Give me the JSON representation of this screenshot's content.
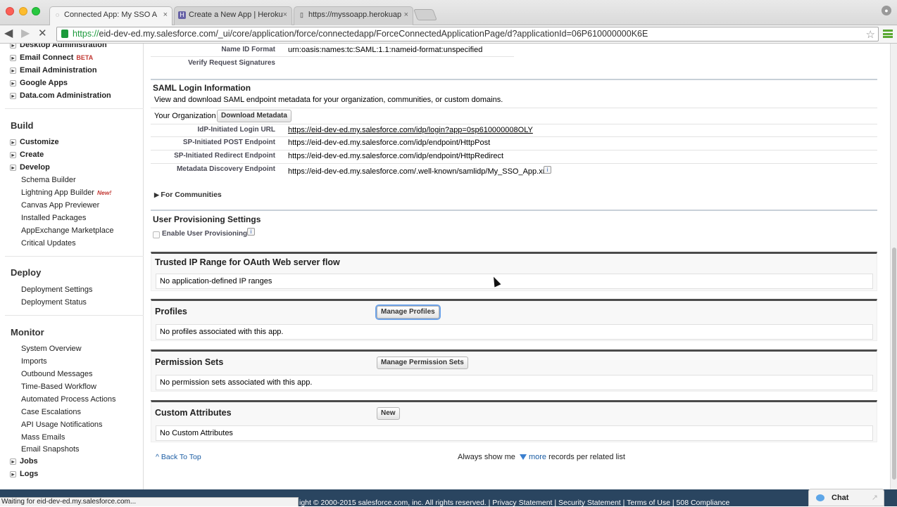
{
  "browser": {
    "tabs": [
      {
        "title": "Connected App: My SSO A",
        "active": true,
        "icon": "loading-spinner-icon"
      },
      {
        "title": "Create a New App | Heroku",
        "active": false,
        "icon": "heroku-icon"
      },
      {
        "title": "https://myssoapp.herokuap",
        "active": false,
        "icon": "page-icon"
      }
    ],
    "url_scheme": "https://",
    "url_rest": "eid-dev-ed.my.salesforce.com/_ui/core/application/force/connectedapp/ForceConnectedApplicationPage/d?applicationId=06P610000000K6E",
    "status_text": "Waiting for eid-dev-ed.my.salesforce.com..."
  },
  "sidebar": {
    "admin_items": [
      {
        "label": "Desktop Administration"
      },
      {
        "label": "Email Connect",
        "badge": "BETA"
      },
      {
        "label": "Email Administration"
      },
      {
        "label": "Google Apps"
      },
      {
        "label": "Data.com Administration"
      }
    ],
    "build_heading": "Build",
    "build_items": [
      {
        "label": "Customize",
        "expandable": true
      },
      {
        "label": "Create",
        "expandable": true
      },
      {
        "label": "Develop",
        "expandable": true
      },
      {
        "label": "Schema Builder"
      },
      {
        "label": "Lightning App Builder",
        "badge": "New!"
      },
      {
        "label": "Canvas App Previewer"
      },
      {
        "label": "Installed Packages"
      },
      {
        "label": "AppExchange Marketplace"
      },
      {
        "label": "Critical Updates"
      }
    ],
    "deploy_heading": "Deploy",
    "deploy_items": [
      {
        "label": "Deployment Settings"
      },
      {
        "label": "Deployment Status"
      }
    ],
    "monitor_heading": "Monitor",
    "monitor_items": [
      {
        "label": "System Overview"
      },
      {
        "label": "Imports"
      },
      {
        "label": "Outbound Messages"
      },
      {
        "label": "Time-Based Workflow"
      },
      {
        "label": "Automated Process Actions"
      },
      {
        "label": "Case Escalations"
      },
      {
        "label": "API Usage Notifications"
      },
      {
        "label": "Mass Emails"
      },
      {
        "label": "Email Snapshots"
      },
      {
        "label": "Jobs",
        "expandable": true
      },
      {
        "label": "Logs",
        "expandable": true
      }
    ]
  },
  "saml_top": {
    "name_id_label": "Name ID Format",
    "name_id_value": "urn:oasis:names:tc:SAML:1.1:nameid-format:unspecified",
    "verify_label": "Verify Request Signatures"
  },
  "saml_login": {
    "title": "SAML Login Information",
    "description": "View and download SAML endpoint metadata for your organization, communities, or custom domains.",
    "your_org_label": "Your Organization",
    "download_button": "Download Metadata",
    "fields": [
      {
        "label": "IdP-Initiated Login URL",
        "value": "https://eid-dev-ed.my.salesforce.com/idp/login?app=0sp610000008OLY"
      },
      {
        "label": "SP-Initiated POST Endpoint",
        "value": "https://eid-dev-ed.my.salesforce.com/idp/endpoint/HttpPost"
      },
      {
        "label": "SP-Initiated Redirect Endpoint",
        "value": "https://eid-dev-ed.my.salesforce.com/idp/endpoint/HttpRedirect"
      },
      {
        "label": "Metadata Discovery Endpoint",
        "value": "https://eid-dev-ed.my.salesforce.com/.well-known/samlidp/My_SSO_App.xml"
      }
    ],
    "communities_toggle": "For Communities"
  },
  "user_provisioning": {
    "title": "User Provisioning Settings",
    "enable_label": "Enable User Provisioning"
  },
  "related_lists": [
    {
      "title": "Trusted IP Range for OAuth Web server flow",
      "body": "No application-defined IP ranges",
      "button": ""
    },
    {
      "title": "Profiles",
      "body": "No profiles associated with this app.",
      "button": "Manage Profiles"
    },
    {
      "title": "Permission Sets",
      "body": "No permission sets associated with this app.",
      "button": "Manage Permission Sets"
    },
    {
      "title": "Custom Attributes",
      "body": "No Custom Attributes",
      "button": "New"
    }
  ],
  "footer": {
    "back_to_top": "Back To Top",
    "always_show_prefix": "Always show me",
    "always_show_more": "more",
    "always_show_suffix": "records per related list",
    "copyright": "ight © 2000-2015 salesforce.com, inc. All rights reserved. | Privacy Statement | Security Statement | Terms of Use | 508 Compliance",
    "chat_label": "Chat"
  },
  "colors": {
    "footer_bg": "#2a4560",
    "link": "#1a5ca3",
    "secure_green": "#1b9a3b"
  }
}
